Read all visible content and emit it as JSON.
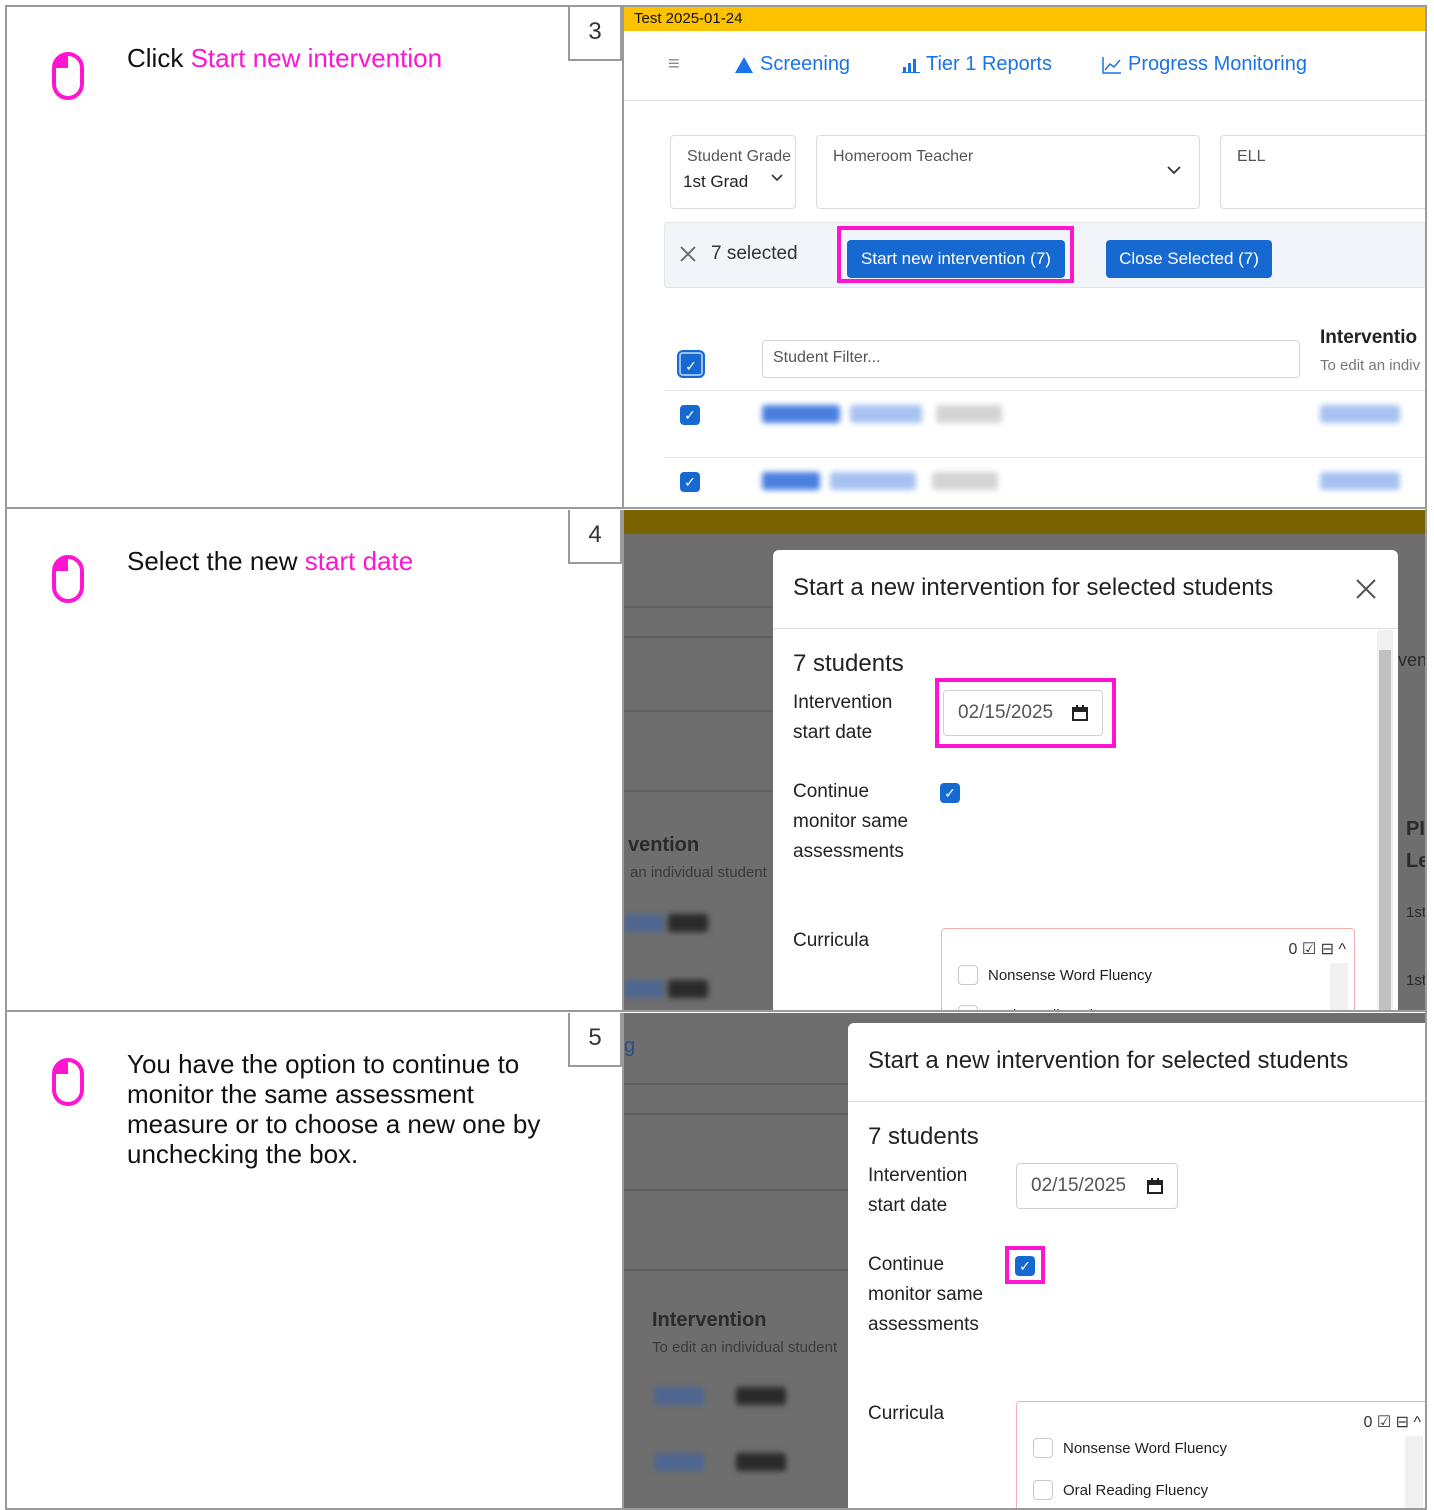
{
  "steps": [
    {
      "number": "3",
      "text_before": "Click ",
      "highlight": "Start new intervention",
      "text_after": ""
    },
    {
      "number": "4",
      "text_before": "Select the new ",
      "highlight": "start date",
      "text_after": ""
    },
    {
      "number": "5",
      "text_before": "You have the option to continue to monitor the same assessment measure or to choose a new one by unchecking the box.",
      "highlight": "",
      "text_after": ""
    }
  ],
  "app": {
    "banner": "Test 2025-01-24",
    "nav": {
      "menu_icon": "≡",
      "screening": "Screening",
      "tier1": "Tier 1 Reports",
      "progress": "Progress Monitoring"
    },
    "filters": {
      "grade_label": "Student Grade",
      "grade_value": "1st Grad",
      "teacher_label": "Homeroom Teacher",
      "ell_label": "ELL"
    },
    "selection": {
      "count": "7 selected",
      "start_button": "Start new intervention (7)",
      "close_button": "Close Selected (7)"
    },
    "student_filter_placeholder": "Student Filter...",
    "intervention_header": "Interventio",
    "intervention_sub": "To edit an indiv"
  },
  "step4_bg": {
    "header": "vention",
    "sub": "an individual student",
    "right_partial": "ven",
    "pm_partial_1": "PI",
    "pm_partial_2": "Le",
    "grade_partial_1": "1st",
    "grade_partial_2": "1st"
  },
  "step5_bg": {
    "nav_partial": "g",
    "header": "Intervention",
    "sub": "To edit an individual student"
  },
  "modal": {
    "title": "Start a new intervention for selected students",
    "close_icon": "×",
    "count": "7 students",
    "date_label": "Intervention start date",
    "date_value": "02/15/2025",
    "continue_label": "Continue monitor same assessments",
    "curricula_label": "Curricula",
    "curricula_controls": "0",
    "curricula": [
      "Nonsense Word Fluency",
      "Oral Reading Fluency"
    ]
  },
  "colors": {
    "highlight": "#ff14d2",
    "primary": "#1769d2",
    "banner": "#fcc200"
  }
}
